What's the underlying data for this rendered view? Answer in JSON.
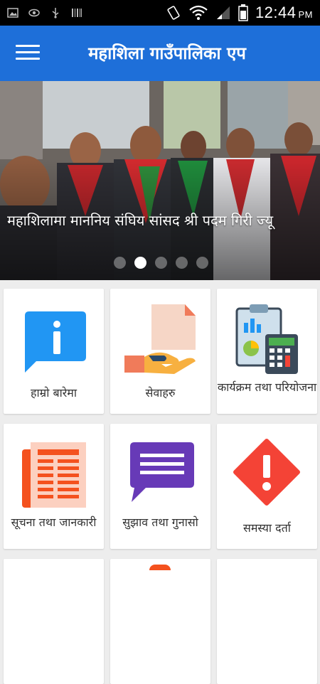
{
  "status_bar": {
    "time": "12:44",
    "ampm": "PM",
    "icons": [
      "image-icon",
      "eye-icon",
      "usb-icon",
      "barcode-icon",
      "vibrate-icon",
      "wifi-icon",
      "signal-icon",
      "battery-icon"
    ]
  },
  "app_bar": {
    "menu_icon": "hamburger-icon",
    "title": "महाशिला गाउँपालिका एप"
  },
  "banner": {
    "caption": "महाशिलामा माननिय संघिय सांसद श्री पदम गिरी ज्यू",
    "slide_count": 5,
    "active_slide": 2
  },
  "tiles": [
    {
      "label": "हाम्रो बारेमा",
      "icon": "info-bubble-icon",
      "color": "#2196f3"
    },
    {
      "label": "सेवाहरु",
      "icon": "service-hand-icon",
      "color": "#f5a623"
    },
    {
      "label": "कार्यक्रम तथा परियोजना",
      "icon": "clipboard-calculator-icon",
      "color": "#3b4a5a"
    },
    {
      "label": "सूचना तथा जानकारी",
      "icon": "newspaper-icon",
      "color": "#f4511e"
    },
    {
      "label": "सुझाव तथा गुनासो",
      "icon": "chat-bubble-icon",
      "color": "#673ab7"
    },
    {
      "label": "समस्या दर्ता",
      "icon": "warning-icon",
      "color": "#f44336"
    }
  ]
}
